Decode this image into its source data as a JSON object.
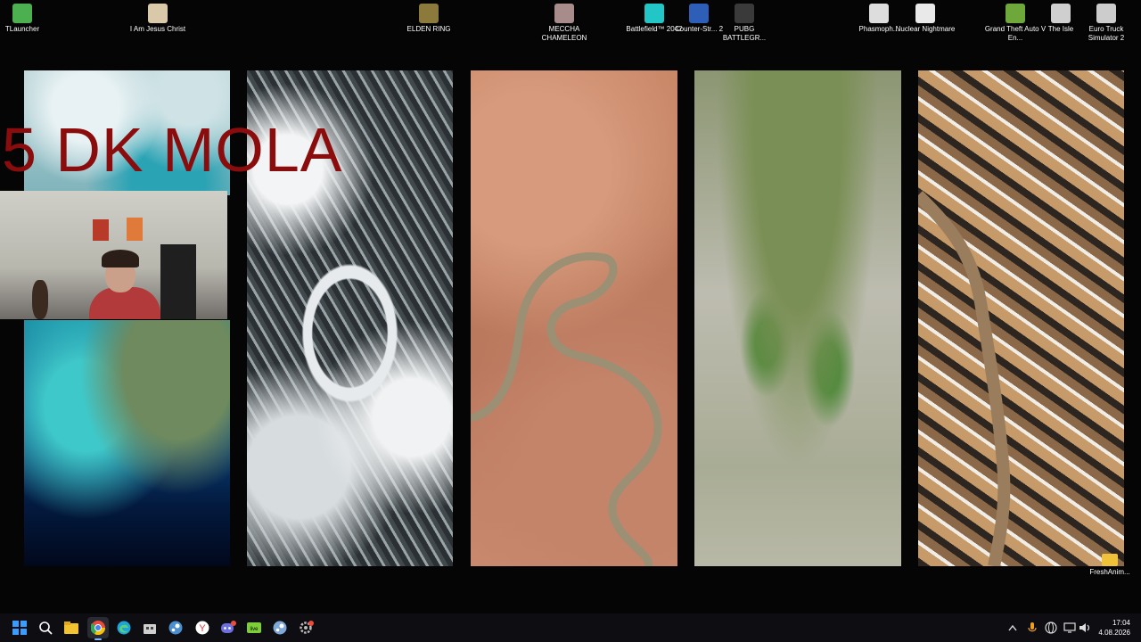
{
  "desktop": {
    "icons": [
      {
        "label": "TLauncher",
        "color": "#4caf50",
        "icon": "tlauncher-icon"
      },
      {
        "label": "I Am Jesus Christ",
        "color": "#d9c9a8",
        "icon": "jesus-game-icon"
      },
      {
        "label": "ELDEN RING",
        "color": "#8c7a3c",
        "icon": "elden-ring-icon"
      },
      {
        "label": "MECCHA CHAMELEON",
        "color": "#a88c8c",
        "icon": "meccha-chameleon-icon"
      },
      {
        "label": "Battlefield™ 2042",
        "color": "#22c6c6",
        "icon": "battlefield-icon"
      },
      {
        "label": "Counter-Str... 2",
        "color": "#2e5fb8",
        "icon": "counter-strike-icon"
      },
      {
        "label": "PUBG BATTLEGR...",
        "color": "#3a3a3a",
        "icon": "pubg-icon"
      },
      {
        "label": "Phasmoph...",
        "color": "#dddddd",
        "icon": "phasmophobia-icon"
      },
      {
        "label": "Nuclear Nightmare",
        "color": "#e9e9e9",
        "icon": "nuclear-nightmare-icon"
      },
      {
        "label": "Grand Theft Auto V En...",
        "color": "#6fa83a",
        "icon": "gta-icon"
      },
      {
        "label": "The Isle",
        "color": "#cfcfcf",
        "icon": "the-isle-icon"
      },
      {
        "label": "Euro Truck Simulator 2",
        "color": "#cccccc",
        "icon": "euro-truck-icon"
      },
      {
        "label": "FreshAnim...",
        "color": "#f0c23a",
        "icon": "folder-icon"
      }
    ]
  },
  "video": {
    "overlay_text": "5 DK MOLA"
  },
  "taskbar": {
    "apps": [
      {
        "name": "start-button",
        "icon": "windows-icon",
        "color": "#3b9cff"
      },
      {
        "name": "search-button",
        "icon": "search-icon",
        "color": "#ffffff"
      },
      {
        "name": "file-explorer-button",
        "icon": "folder-icon",
        "color": "#f2c230"
      },
      {
        "name": "chrome-button",
        "icon": "chrome-icon",
        "color": "#e74c3c"
      },
      {
        "name": "edge-button",
        "icon": "edge-icon",
        "color": "#1fa3d8"
      },
      {
        "name": "store-button",
        "icon": "store-icon",
        "color": "#cccccc"
      },
      {
        "name": "steam-button",
        "icon": "steam-icon",
        "color": "#4b8fcf"
      },
      {
        "name": "yandex-button",
        "icon": "yandex-icon",
        "color": "#e03b3b"
      },
      {
        "name": "discord-button",
        "icon": "discord-icon",
        "color": "#6c6fe0"
      },
      {
        "name": "live-button",
        "icon": "live-icon",
        "color": "#7ccf39"
      },
      {
        "name": "steam-alt-button",
        "icon": "steam-icon",
        "color": "#7fa8d6"
      },
      {
        "name": "settings-button",
        "icon": "settings-icon",
        "color": "#bbbbbb"
      }
    ],
    "clock": {
      "time": "17:04",
      "date": "4.08.2026"
    }
  }
}
